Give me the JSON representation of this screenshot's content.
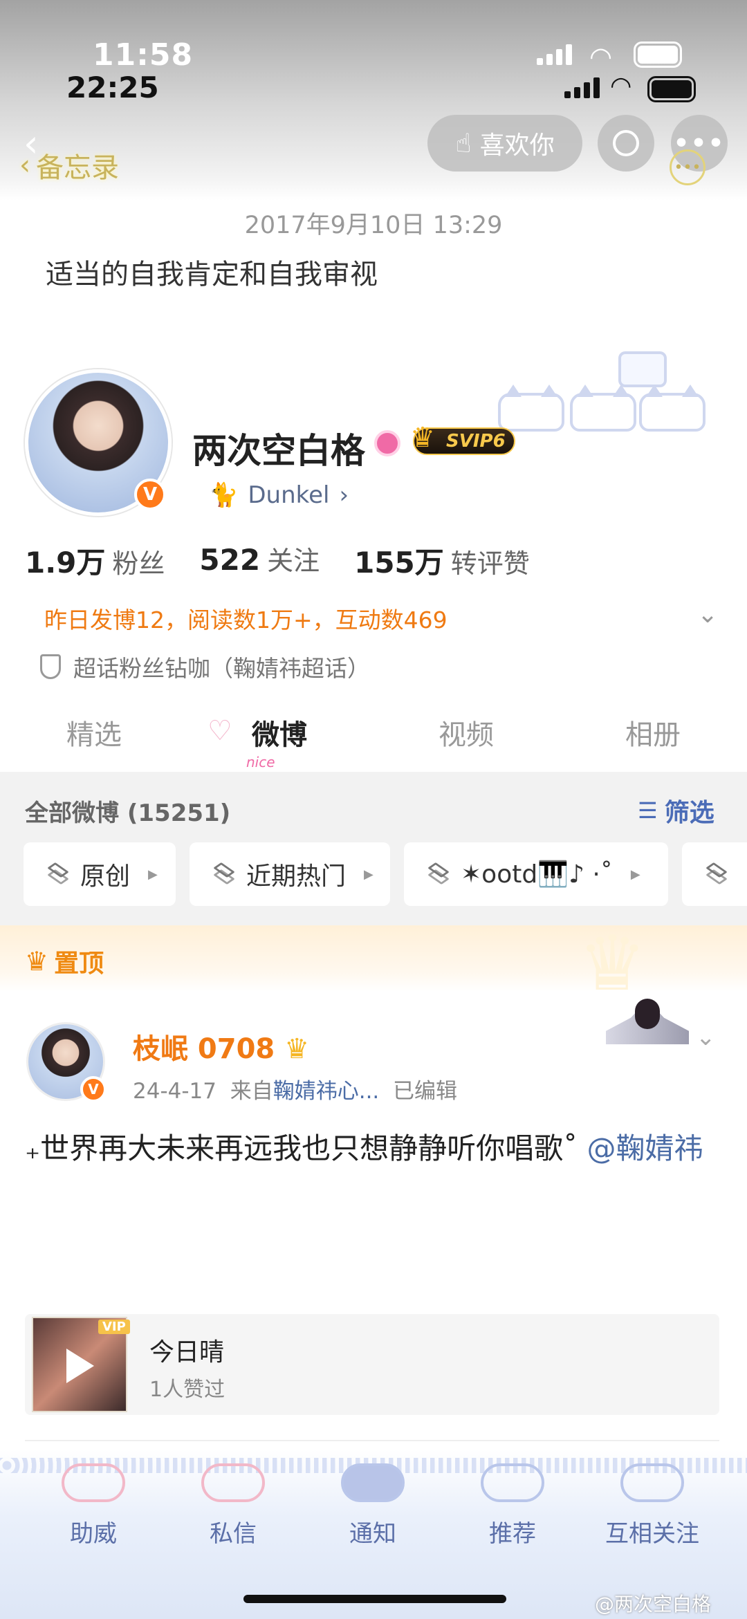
{
  "status": {
    "time_outer": "11:58",
    "time_inner": "22:25"
  },
  "header": {
    "like_label": "喜欢你",
    "back_label": "备忘录"
  },
  "memo": {
    "date": "2017年9月10日 13:29",
    "text": "适当的自我肯定和自我审视"
  },
  "profile": {
    "name": "两次空白格",
    "vip": "SVIP6",
    "verify": "V",
    "link_name": "Dunkel",
    "stats": [
      {
        "value": "1.9万",
        "label": "粉丝"
      },
      {
        "value": "522",
        "label": "关注"
      },
      {
        "value": "155万",
        "label": "转评赞"
      }
    ],
    "yesterday": "昨日发博12，阅读数1万+，互动数469",
    "superfan": "超话粉丝钻咖（鞠婧祎超话）"
  },
  "tabs": [
    {
      "label": "精选"
    },
    {
      "label": "微博"
    },
    {
      "label": "视频"
    },
    {
      "label": "相册"
    }
  ],
  "tab_decoration": "nice",
  "feed": {
    "all_label": "全部微博 (15251)",
    "filter_label": "筛选",
    "chips": [
      {
        "label": "原创"
      },
      {
        "label": "近期热门"
      },
      {
        "label": "✶ootd🎹♪ ·˚"
      }
    ]
  },
  "pinned": {
    "label": "置顶"
  },
  "post": {
    "author": "枝岷 0708",
    "date": "24-4-17",
    "from_prefix": "来自",
    "source": "鞠婧祎心...",
    "edited": "已编辑",
    "text": "₊世界再大未来再远我也只想静静听你唱歌˚",
    "mention": "@鞠婧祎",
    "music": {
      "title": "今日晴",
      "likes": "1人赞过",
      "badge": "VIP"
    }
  },
  "bottom_nav": [
    {
      "label": "助威"
    },
    {
      "label": "私信"
    },
    {
      "label": "通知"
    },
    {
      "label": "推荐"
    },
    {
      "label": "互相关注"
    }
  ],
  "watermark": "@两次空白格",
  "colors": {
    "orange": "#ef7a12",
    "link_blue": "#4b6ca6",
    "nav_blue": "#5b6fa8"
  }
}
